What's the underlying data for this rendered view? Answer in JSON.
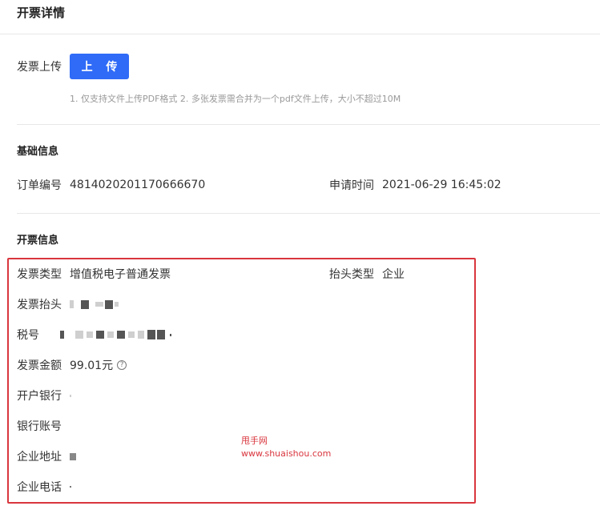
{
  "header": {
    "title": "开票详情"
  },
  "upload": {
    "label": "发票上传",
    "button_label": "上 传",
    "hint": "1. 仅支持文件上传PDF格式 2. 多张发票需合并为一个pdf文件上传，大小不超过10M"
  },
  "basic_info": {
    "title": "基础信息",
    "order_no_label": "订单编号",
    "order_no": "4814020201170666670",
    "apply_time_label": "申请时间",
    "apply_time": "2021-06-29 16:45:02"
  },
  "invoice_info": {
    "title": "开票信息",
    "type_label": "发票类型",
    "type_value": "增值税电子普通发票",
    "header_type_label": "抬头类型",
    "header_type_value": "企业",
    "invoice_header_label": "发票抬头",
    "tax_no_label": "税号",
    "amount_label": "发票金额",
    "amount_value": "99.01元",
    "help_glyph": "?",
    "bank_label": "开户银行",
    "bank_account_label": "银行账号",
    "address_label": "企业地址",
    "phone_label": "企业电话"
  },
  "watermark": {
    "line1": "甩手网",
    "line2": "www.shuaishou.com"
  },
  "colors": {
    "primary": "#2f6bf7",
    "highlight": "#d9363e"
  }
}
